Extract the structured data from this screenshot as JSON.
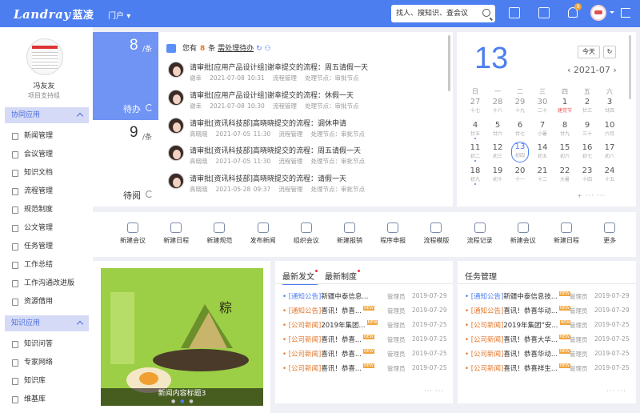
{
  "header": {
    "logo_en": "Landray",
    "logo_cn": "蓝凌",
    "portal_label": "门户",
    "search_placeholder": "找人、搜知识、查会议",
    "notification_count": "9"
  },
  "user": {
    "name": "冯友友",
    "role": "项目支持组"
  },
  "sidebar": {
    "sections": [
      {
        "label": "协同应用",
        "items": [
          "新闻管理",
          "会议管理",
          "知识文档",
          "流程管理",
          "规范制度",
          "公文管理",
          "任务管理",
          "工作总结",
          "工作沟通改进版",
          "资源借用"
        ]
      },
      {
        "label": "知识应用",
        "items": [
          "知识问答",
          "专家网络",
          "知识库",
          "维基库"
        ]
      }
    ]
  },
  "todo": {
    "pending_count": "8",
    "pending_unit": "/条",
    "pending_label": "待办",
    "toread_count": "9",
    "toread_unit": "/条",
    "toread_label": "待阅"
  },
  "todo_list": {
    "summary_prefix": "您有",
    "summary_count": "8",
    "summary_suffix": "条",
    "summary_link": "需处理待办",
    "items": [
      {
        "title": "请审批[应用产品设计组]谢幸提交的流程：周五请假一天",
        "user": "谢幸",
        "time": "2021-07-08 10:31",
        "module": "流程管理",
        "node": "处理节点：审批节点"
      },
      {
        "title": "请审批[应用产品设计组]谢幸提交的流程：休假一天",
        "user": "谢幸",
        "time": "2021-07-08 10:30",
        "module": "流程管理",
        "node": "处理节点：审批节点"
      },
      {
        "title": "请审批[资讯科技部]高晓晓提交的流程：调休申请",
        "user": "高晓晓",
        "time": "2021-07-05 11:30",
        "module": "流程管理",
        "node": "处理节点：审批节点"
      },
      {
        "title": "请审批[资讯科技部]高晓晓提交的流程：周五请假一天",
        "user": "高晓晓",
        "time": "2021-07-05 11:30",
        "module": "流程管理",
        "node": "处理节点：审批节点"
      },
      {
        "title": "请审批[资讯科技部]高晓晓提交的流程：请假一天",
        "user": "高晓晓",
        "time": "2021-05-28 09:37",
        "module": "流程管理",
        "node": "处理节点：审批节点"
      }
    ]
  },
  "calendar": {
    "day": "13",
    "today_btn": "今天",
    "month_label": "2021-07",
    "weekdays": [
      "日",
      "一",
      "二",
      "三",
      "四",
      "五",
      "六"
    ],
    "weeks": [
      [
        {
          "n": "27",
          "l": "十七",
          "cur": false,
          "dot": false
        },
        {
          "n": "28",
          "l": "十八",
          "cur": false,
          "dot": false
        },
        {
          "n": "29",
          "l": "十九",
          "cur": false,
          "dot": false
        },
        {
          "n": "30",
          "l": "二十",
          "cur": false,
          "dot": false
        },
        {
          "n": "1",
          "l": "建党节",
          "cur": true,
          "dot": false,
          "red": true
        },
        {
          "n": "2",
          "l": "廿三",
          "cur": true,
          "dot": false
        },
        {
          "n": "3",
          "l": "廿四",
          "cur": true,
          "dot": false
        }
      ],
      [
        {
          "n": "4",
          "l": "廿五",
          "cur": true,
          "dot": true
        },
        {
          "n": "5",
          "l": "廿六",
          "cur": true,
          "dot": false
        },
        {
          "n": "6",
          "l": "廿七",
          "cur": true,
          "dot": false
        },
        {
          "n": "7",
          "l": "小暑",
          "cur": true,
          "dot": false
        },
        {
          "n": "8",
          "l": "廿九",
          "cur": true,
          "dot": false
        },
        {
          "n": "9",
          "l": "三十",
          "cur": true,
          "dot": false
        },
        {
          "n": "10",
          "l": "六月",
          "cur": true,
          "dot": false
        }
      ],
      [
        {
          "n": "11",
          "l": "初二",
          "cur": true,
          "dot": true
        },
        {
          "n": "12",
          "l": "初三",
          "cur": true,
          "dot": false
        },
        {
          "n": "13",
          "l": "初四",
          "cur": true,
          "dot": false,
          "today": true
        },
        {
          "n": "14",
          "l": "初五",
          "cur": true,
          "dot": false
        },
        {
          "n": "15",
          "l": "初六",
          "cur": true,
          "dot": false
        },
        {
          "n": "16",
          "l": "初七",
          "cur": true,
          "dot": false
        },
        {
          "n": "17",
          "l": "初八",
          "cur": true,
          "dot": false
        }
      ],
      [
        {
          "n": "18",
          "l": "初九",
          "cur": true,
          "dot": true
        },
        {
          "n": "19",
          "l": "初十",
          "cur": true,
          "dot": false
        },
        {
          "n": "20",
          "l": "十一",
          "cur": true,
          "dot": false
        },
        {
          "n": "21",
          "l": "十二",
          "cur": true,
          "dot": false
        },
        {
          "n": "22",
          "l": "大暑",
          "cur": true,
          "dot": false
        },
        {
          "n": "23",
          "l": "十四",
          "cur": true,
          "dot": false
        },
        {
          "n": "24",
          "l": "十五",
          "cur": true,
          "dot": false
        }
      ]
    ]
  },
  "quick_actions": [
    "新建会议",
    "新建日程",
    "新建规范",
    "发布新闻",
    "组织会议",
    "新建报销",
    "程序申报",
    "流程模版",
    "流程记录",
    "新建会议",
    "新建日程",
    "更多"
  ],
  "news_image": {
    "caption": "新闻内容标题3"
  },
  "news_panel": {
    "tabs": [
      "最新发文",
      "最新制度"
    ],
    "items": [
      {
        "tag": "[通知公告]",
        "title": "新疆中泰信息...",
        "new": false,
        "author": "管理员",
        "date": "2019-07-29",
        "blue": true
      },
      {
        "tag": "[通知公告]",
        "title": "喜讯！恭喜...",
        "new": true,
        "author": "管理员",
        "date": "2019-07-29",
        "blue": false
      },
      {
        "tag": "[公司新闻]",
        "title": "2019年集团...",
        "new": true,
        "author": "管理员",
        "date": "2019-07-25",
        "blue": false
      },
      {
        "tag": "[公司新闻]",
        "title": "喜讯！恭喜...",
        "new": true,
        "author": "管理员",
        "date": "2019-07-25",
        "blue": false
      },
      {
        "tag": "[公司新闻]",
        "title": "喜讯！恭喜...",
        "new": true,
        "author": "管理员",
        "date": "2019-07-25",
        "blue": false
      },
      {
        "tag": "[公司新闻]",
        "title": "喜讯！恭喜...",
        "new": true,
        "author": "管理员",
        "date": "2019-07-25",
        "blue": false
      }
    ]
  },
  "task_panel": {
    "title": "任务管理",
    "items": [
      {
        "tag": "[通知公告]",
        "title": "新疆中泰信息技...",
        "new": true,
        "author": "管理员",
        "date": "2019-07-29",
        "blue": true
      },
      {
        "tag": "[通知公告]",
        "title": "喜讯！恭喜华动...",
        "new": true,
        "author": "管理员",
        "date": "2019-07-29",
        "blue": false
      },
      {
        "tag": "[公司新闻]",
        "title": "2019年集团“安...",
        "new": true,
        "author": "管理员",
        "date": "2019-07-25",
        "blue": false
      },
      {
        "tag": "[公司新闻]",
        "title": "喜讯！恭喜大华...",
        "new": true,
        "author": "管理员",
        "date": "2019-07-25",
        "blue": false
      },
      {
        "tag": "[公司新闻]",
        "title": "喜讯！恭喜华动...",
        "new": true,
        "author": "管理员",
        "date": "2019-07-25",
        "blue": false
      },
      {
        "tag": "[公司新闻]",
        "title": "喜讯！恭喜祥生...",
        "new": true,
        "author": "管理员",
        "date": "2019-07-25",
        "blue": false
      }
    ]
  }
}
